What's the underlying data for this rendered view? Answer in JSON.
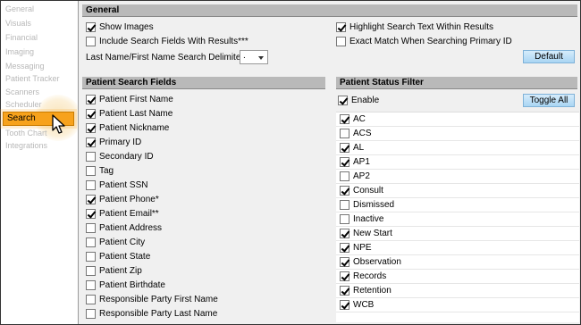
{
  "sidebar": {
    "items": [
      {
        "label": "General",
        "active": false
      },
      {
        "label": "Visuals",
        "active": false
      },
      {
        "label": "Financial",
        "active": false
      },
      {
        "label": "Imaging",
        "active": false
      },
      {
        "label": "Messaging",
        "active": false
      },
      {
        "label": "Patient Tracker",
        "active": false
      },
      {
        "label": "Scanners",
        "active": false
      },
      {
        "label": "Scheduler",
        "active": false
      },
      {
        "label": "Search",
        "active": true
      },
      {
        "label": "Tooth Chart",
        "active": false
      },
      {
        "label": "Integrations",
        "active": false
      }
    ]
  },
  "general": {
    "header": "General",
    "left_options": [
      {
        "label": "Show Images",
        "checked": true
      },
      {
        "label": "Include Search Fields With Results***",
        "checked": false
      }
    ],
    "right_options": [
      {
        "label": "Highlight Search Text Within Results",
        "checked": true
      },
      {
        "label": "Exact Match When Searching Primary ID",
        "checked": false
      }
    ],
    "delimiter_label": "Last Name/First Name Search Delimiter:",
    "delimiter_value": ".",
    "default_button": "Default"
  },
  "search_fields": {
    "header": "Patient Search Fields",
    "items": [
      {
        "label": "Patient First Name",
        "checked": true
      },
      {
        "label": "Patient Last Name",
        "checked": true
      },
      {
        "label": "Patient Nickname",
        "checked": true
      },
      {
        "label": "Primary ID",
        "checked": true
      },
      {
        "label": "Secondary ID",
        "checked": false
      },
      {
        "label": "Tag",
        "checked": false
      },
      {
        "label": "Patient SSN",
        "checked": false
      },
      {
        "label": "Patient Phone*",
        "checked": true
      },
      {
        "label": "Patient Email**",
        "checked": true
      },
      {
        "label": "Patient Address",
        "checked": false
      },
      {
        "label": "Patient City",
        "checked": false
      },
      {
        "label": "Patient State",
        "checked": false
      },
      {
        "label": "Patient Zip",
        "checked": false
      },
      {
        "label": "Patient Birthdate",
        "checked": false
      },
      {
        "label": "Responsible Party First Name",
        "checked": false
      },
      {
        "label": "Responsible Party Last Name",
        "checked": false
      }
    ]
  },
  "status_filter": {
    "header": "Patient Status Filter",
    "enable_label": "Enable",
    "enable_checked": true,
    "toggle_all_button": "Toggle All",
    "items": [
      {
        "label": "AC",
        "checked": true
      },
      {
        "label": "ACS",
        "checked": false
      },
      {
        "label": "AL",
        "checked": true
      },
      {
        "label": "AP1",
        "checked": true
      },
      {
        "label": "AP2",
        "checked": false
      },
      {
        "label": "Consult",
        "checked": true
      },
      {
        "label": "Dismissed",
        "checked": false
      },
      {
        "label": "Inactive",
        "checked": false
      },
      {
        "label": "New Start",
        "checked": true
      },
      {
        "label": "NPE",
        "checked": true
      },
      {
        "label": "Observation",
        "checked": true
      },
      {
        "label": "Records",
        "checked": true
      },
      {
        "label": "Retention",
        "checked": true
      },
      {
        "label": "WCB",
        "checked": true
      }
    ]
  },
  "icons": {
    "cursor": "mouse-pointer-icon",
    "dropdown": "chevron-down-icon",
    "checkbox": "checkmark-icon"
  },
  "colors": {
    "active_nav": "#f7a21c",
    "section_header": "#b9b9b9",
    "button": "#a9d5f3"
  }
}
